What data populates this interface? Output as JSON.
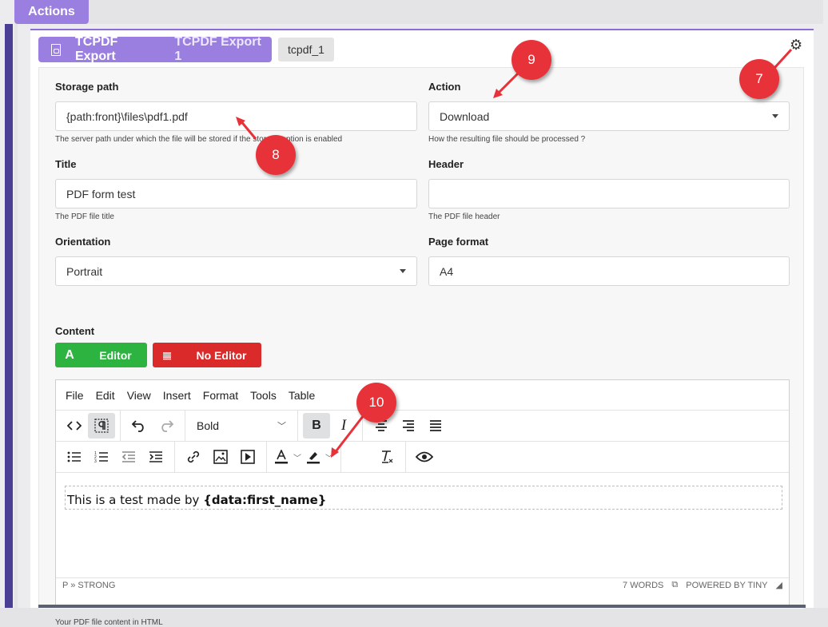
{
  "tab": {
    "label": "Actions"
  },
  "card": {
    "title": "TCPDF Export",
    "subtitle": "TCPDF Export 1",
    "id_badge": "tcpdf_1"
  },
  "fields": {
    "storage_path": {
      "label": "Storage path",
      "value": "{path:front}\\files\\pdf1.pdf",
      "help": "The server path under which the file will be stored if the storage option is enabled"
    },
    "action": {
      "label": "Action",
      "value": "Download",
      "help": "How the resulting file should be processed ?"
    },
    "title": {
      "label": "Title",
      "value": "PDF form test",
      "help": "The PDF file title"
    },
    "header": {
      "label": "Header",
      "value": "",
      "help": "The PDF file header"
    },
    "orientation": {
      "label": "Orientation",
      "value": "Portrait"
    },
    "page_format": {
      "label": "Page format",
      "value": "A4"
    }
  },
  "content": {
    "label": "Content",
    "editor_button": {
      "glyph": "A",
      "label": "Editor"
    },
    "no_editor_button": {
      "glyph": "≣",
      "label": "No Editor"
    },
    "help": "Your PDF file content in HTML"
  },
  "editor": {
    "menu": [
      "File",
      "Edit",
      "View",
      "Insert",
      "Format",
      "Tools",
      "Table"
    ],
    "block_format": "Bold",
    "body_prefix": "This is a test made by ",
    "body_strong": "{data:first_name}",
    "status_path": "P » STRONG",
    "word_count": "7 WORDS",
    "powered_by": "POWERED BY TINY"
  },
  "markers": [
    "7",
    "8",
    "9",
    "10"
  ],
  "colors": {
    "accent_purple": "#9b7fe0",
    "editor_green": "#2db340",
    "no_editor_red": "#da2a2a",
    "marker_red": "#e8323a",
    "sidebar_strip": "#4b3f93"
  },
  "icons": {
    "settings": "gear-icon",
    "pdf": "pdf-file-icon"
  }
}
